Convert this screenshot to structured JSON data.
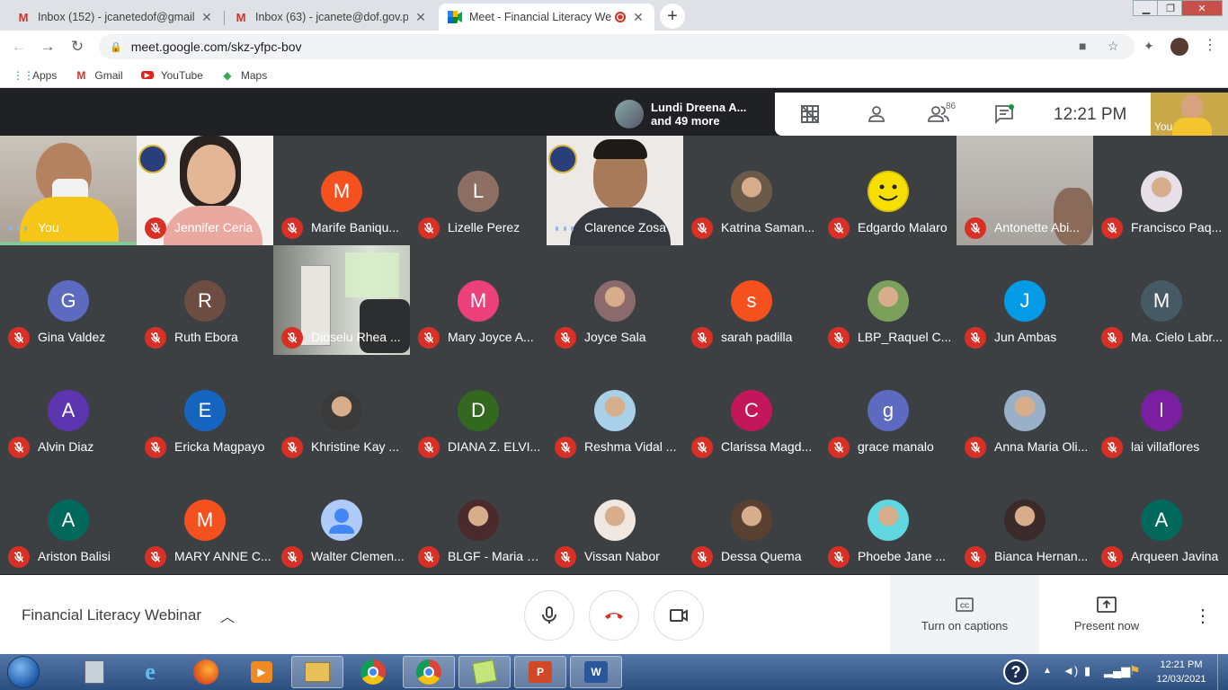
{
  "browser": {
    "tabs": [
      {
        "title": "Inbox (152) - jcanetedof@gmail.c",
        "icon": "gmail-icon",
        "active": false
      },
      {
        "title": "Inbox (63) - jcanete@dof.gov.ph",
        "icon": "gmail-icon",
        "active": false
      },
      {
        "title": "Meet - Financial Literacy We",
        "icon": "meet-icon",
        "active": true
      }
    ],
    "url": "meet.google.com/skz-yfpc-bov",
    "bookmarks": [
      {
        "label": "Apps",
        "icon": "apps-grid-icon"
      },
      {
        "label": "Gmail",
        "icon": "gmail-icon"
      },
      {
        "label": "YouTube",
        "icon": "youtube-icon"
      },
      {
        "label": "Maps",
        "icon": "maps-icon"
      }
    ]
  },
  "meet": {
    "presenter": {
      "line1": "Lundi Dreena A...",
      "line2": "and 49 more"
    },
    "participant_count": "86",
    "clock": "12:21 PM",
    "self_label": "You",
    "meeting_name": "Financial Literacy Webinar",
    "actions": {
      "captions": "Turn on captions",
      "present": "Present now"
    },
    "participants": [
      {
        "name": "You",
        "type": "video",
        "muted": false
      },
      {
        "name": "Jennifer Ceria",
        "type": "video",
        "muted": true
      },
      {
        "name": "Marife Baniqu...",
        "letter": "M",
        "color": "#f4511e",
        "muted": true
      },
      {
        "name": "Lizelle Perez",
        "letter": "L",
        "color": "#8d6e63",
        "muted": true
      },
      {
        "name": "Clarence Zosa",
        "type": "video",
        "muted": false
      },
      {
        "name": "Katrina Saman...",
        "photo": "#6b5a4a",
        "muted": true
      },
      {
        "name": "Edgardo Malaro",
        "photo": "#f5d90a",
        "muted": true
      },
      {
        "name": "Antonette Abi...",
        "type": "video",
        "muted": true
      },
      {
        "name": "Francisco Paq...",
        "photo": "#e8e0e8",
        "muted": true
      },
      {
        "name": "Gina Valdez",
        "letter": "G",
        "color": "#5c6bc0",
        "muted": true
      },
      {
        "name": "Ruth Ebora",
        "letter": "R",
        "color": "#6d4c41",
        "muted": true
      },
      {
        "name": "Dioselu Rhea ...",
        "type": "video",
        "muted": true
      },
      {
        "name": "Mary Joyce A...",
        "letter": "M",
        "color": "#ec407a",
        "muted": true
      },
      {
        "name": "Joyce Sala",
        "photo": "#8a6a6a",
        "muted": true
      },
      {
        "name": "sarah padilla",
        "letter": "s",
        "color": "#f4511e",
        "muted": true
      },
      {
        "name": "LBP_Raquel C...",
        "photo": "#7aa05a",
        "muted": true
      },
      {
        "name": "Jun Ambas",
        "letter": "J",
        "color": "#039be5",
        "muted": true
      },
      {
        "name": "Ma. Cielo Labr...",
        "letter": "M",
        "color": "#455a64",
        "muted": true
      },
      {
        "name": "Alvin Diaz",
        "letter": "A",
        "color": "#5e35b1",
        "muted": true
      },
      {
        "name": "Ericka Magpayo",
        "letter": "E",
        "color": "#1565c0",
        "muted": true
      },
      {
        "name": "Khristine Kay ...",
        "photo": "#3a3a3a",
        "muted": true
      },
      {
        "name": "DIANA Z. ELVI...",
        "letter": "D",
        "color": "#33691e",
        "muted": true
      },
      {
        "name": "Reshma Vidal ...",
        "photo": "#a8d0e8",
        "muted": true
      },
      {
        "name": "Clarissa Magd...",
        "letter": "C",
        "color": "#c2185b",
        "muted": true
      },
      {
        "name": "grace manalo",
        "letter": "g",
        "color": "#5c6bc0",
        "muted": true
      },
      {
        "name": "Anna Maria Oli...",
        "photo": "#9ab0c8",
        "muted": true
      },
      {
        "name": "lai villaflores",
        "letter": "l",
        "color": "#7b1fa2",
        "muted": true
      },
      {
        "name": "Ariston Balisi",
        "letter": "A",
        "color": "#00695c",
        "muted": true
      },
      {
        "name": "MARY ANNE C...",
        "letter": "M",
        "color": "#f4511e",
        "muted": true
      },
      {
        "name": "Walter Clemen...",
        "photo": "#aecbfa",
        "muted": true
      },
      {
        "name": "BLGF - Maria E...",
        "photo": "#4a2a2a",
        "muted": true
      },
      {
        "name": "Vissan Nabor",
        "photo": "#f0e8e0",
        "muted": true
      },
      {
        "name": "Dessa Quema",
        "photo": "#5a4030",
        "muted": true
      },
      {
        "name": "Phoebe Jane ...",
        "photo": "#5fd6e0",
        "muted": true
      },
      {
        "name": "Bianca Hernan...",
        "photo": "#3a2a2a",
        "muted": true
      },
      {
        "name": "Arqueen Javina",
        "letter": "A",
        "color": "#00695c",
        "muted": true
      }
    ]
  },
  "taskbar": {
    "time": "12:21 PM",
    "date": "12/03/2021"
  },
  "colors": {
    "meet_bg": "#202124",
    "tile_bg": "#3c4043",
    "mute_red": "#d93025",
    "hangup_red": "#d93025"
  }
}
